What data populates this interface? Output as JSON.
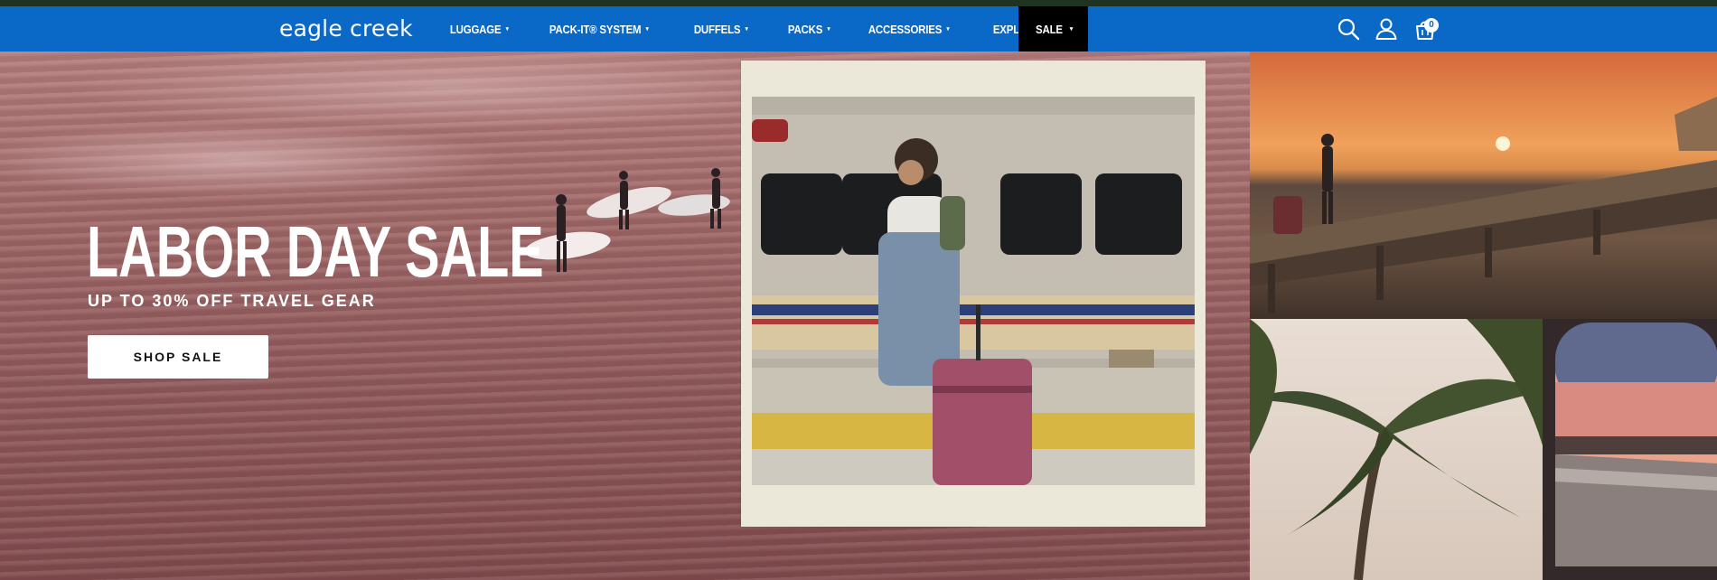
{
  "brand": {
    "logo_text": "eagle creek"
  },
  "nav": {
    "items": [
      {
        "label": "LUGGAGE",
        "caret": "▾"
      },
      {
        "label": "PACK-IT® SYSTEM",
        "caret": "▾"
      },
      {
        "label": "DUFFELS",
        "caret": "▾"
      },
      {
        "label": "PACKS",
        "caret": "▾"
      },
      {
        "label": "ACCESSORIES",
        "caret": "▾"
      },
      {
        "label": "EXPLORE",
        "caret": "▾"
      }
    ],
    "sale": {
      "label": "SALE",
      "caret": "▾"
    },
    "icons": [
      "search-icon",
      "account-icon",
      "cart-icon"
    ],
    "cart_count": "0"
  },
  "hero": {
    "title": "LABOR DAY SALE",
    "subtitle": "UP TO 30% OFF TRAVEL GEAR",
    "cta_label": "SHOP SALE"
  },
  "colors": {
    "nav_blue": "#0a68c6",
    "top_strip": "#1f3322",
    "sale_bg": "#000000",
    "polaroid_frame": "#ebe7d9"
  }
}
